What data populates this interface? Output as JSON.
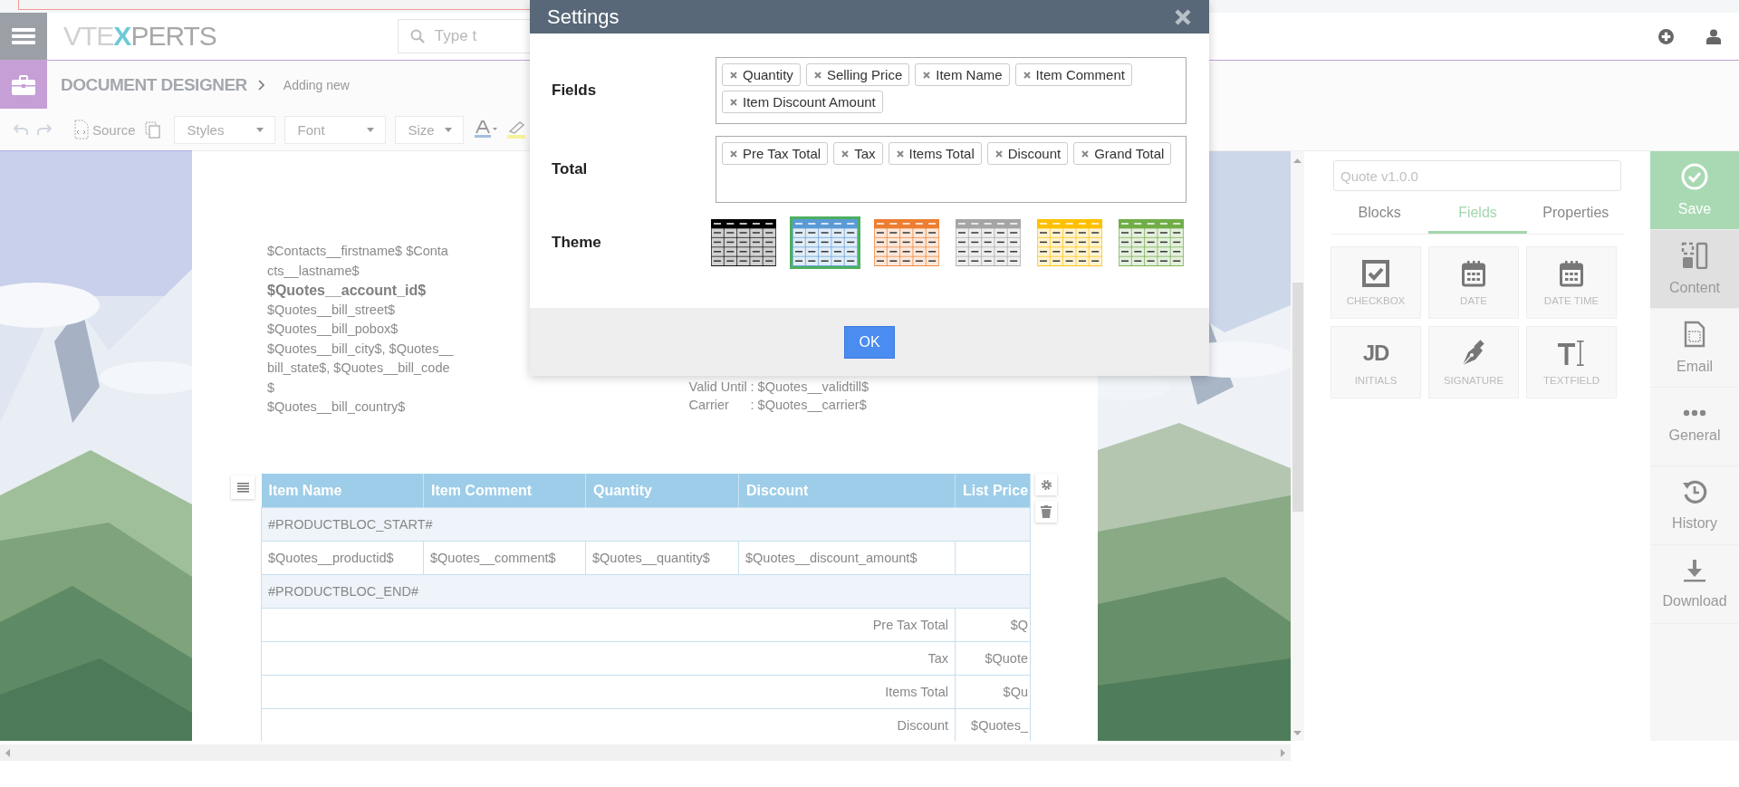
{
  "header": {
    "logo_parts": [
      "VTE",
      "X",
      "PERTS"
    ],
    "search": {
      "placeholder": "Type t"
    }
  },
  "breadcrumb": {
    "module": "DOCUMENT DESIGNER",
    "current": "Adding new"
  },
  "toolbar": {
    "source": "Source",
    "dropdowns": [
      "Styles",
      "Font",
      "Size"
    ]
  },
  "document": {
    "address_lines": [
      {
        "text": "$Contacts__firstname$ $Conta",
        "bold": false
      },
      {
        "text": "cts__lastname$",
        "bold": false
      },
      {
        "text": "$Quotes__account_id$",
        "bold": true
      },
      {
        "text": "$Quotes__bill_street$",
        "bold": false
      },
      {
        "text": "$Quotes__bill_pobox$",
        "bold": false
      },
      {
        "text": "$Quotes__bill_city$, $Quotes__",
        "bold": false
      },
      {
        "text": "bill_state$, $Quotes__bill_code",
        "bold": false
      },
      {
        "text": "$",
        "bold": false
      },
      {
        "text": "$Quotes__bill_country$",
        "bold": false
      }
    ],
    "info_lines": [
      {
        "label": "Valid Until",
        "value": ": $Quotes__validtill$"
      },
      {
        "label": "Carrier",
        "value": ": $Quotes__carrier$"
      }
    ],
    "table": {
      "columns": [
        "Item Name",
        "Item Comment",
        "Quantity",
        "Discount",
        "List Price"
      ],
      "rows": [
        {
          "kind": "marker",
          "text": "#PRODUCTBLOC_START#"
        },
        {
          "kind": "cells",
          "cells": [
            "$Quotes__productid$",
            "$Quotes__comment$",
            "$Quotes__quantity$",
            "$Quotes__discount_amount$"
          ]
        },
        {
          "kind": "marker",
          "text": "#PRODUCTBLOC_END#"
        },
        {
          "kind": "total",
          "label": "Pre Tax Total",
          "value": "$Q"
        },
        {
          "kind": "total",
          "label": "Tax",
          "value": "$Quote"
        },
        {
          "kind": "total",
          "label": "Items Total",
          "value": "$Qu"
        },
        {
          "kind": "total",
          "label": "Discount",
          "value": "$Quotes_"
        }
      ]
    }
  },
  "side_panel": {
    "template_name": "Quote v1.0.0",
    "tabs": [
      {
        "label": "Blocks",
        "selected": false
      },
      {
        "label": "Fields",
        "selected": true
      },
      {
        "label": "Properties",
        "selected": false
      }
    ],
    "fields": [
      {
        "kind": "checkbox",
        "label": "CHECKBOX"
      },
      {
        "kind": "date",
        "label": "DATE"
      },
      {
        "kind": "datetime",
        "label": "DATE TIME"
      },
      {
        "kind": "initials",
        "label": "INITIALS",
        "icon_text": "JD"
      },
      {
        "kind": "signature",
        "label": "SIGNATURE"
      },
      {
        "kind": "textfield",
        "label": "TEXTFIELD"
      }
    ]
  },
  "nav": [
    {
      "kind": "save",
      "label": "Save",
      "selected": false
    },
    {
      "kind": "content",
      "label": "Content",
      "selected": true
    },
    {
      "kind": "email",
      "label": "Email",
      "selected": false
    },
    {
      "kind": "general",
      "label": "General",
      "selected": false
    },
    {
      "kind": "history",
      "label": "History",
      "selected": false
    },
    {
      "kind": "download",
      "label": "Download",
      "selected": false
    }
  ],
  "modal": {
    "title": "Settings",
    "rows": [
      {
        "label": "Fields",
        "tags": [
          "Quantity",
          "Selling Price",
          "Item Name",
          "Item Comment",
          "Item Discount Amount"
        ]
      },
      {
        "label": "Total",
        "tags": [
          "Pre Tax Total",
          "Tax",
          "Items Total",
          "Discount",
          "Grand Total"
        ]
      }
    ],
    "theme": {
      "label": "Theme",
      "options": [
        {
          "color": "#000000",
          "selected": false
        },
        {
          "color": "#5b9bd5",
          "selected": true
        },
        {
          "color": "#ed7d31",
          "selected": false
        },
        {
          "color": "#a5a5a5",
          "selected": false
        },
        {
          "color": "#ffc000",
          "selected": false
        },
        {
          "color": "#70ad47",
          "selected": false
        }
      ]
    },
    "ok": "OK"
  }
}
